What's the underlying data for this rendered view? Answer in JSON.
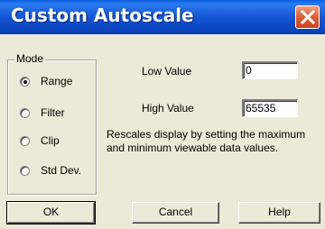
{
  "window": {
    "title": "Custom Autoscale"
  },
  "mode": {
    "label": "Mode",
    "options": [
      "Range",
      "Filter",
      "Clip",
      "Std Dev."
    ],
    "selected": "Range"
  },
  "low": {
    "label": "Low Value",
    "value": "0"
  },
  "high": {
    "label": "High Value",
    "value": "65535"
  },
  "description": "Rescales display by setting the maximum and minimum viewable data values.",
  "buttons": {
    "ok": "OK",
    "cancel": "Cancel",
    "help": "Help"
  },
  "colors": {
    "titlebar": "#0b47c2",
    "close": "#e2603a",
    "dialog_bg": "#ece9d8"
  }
}
